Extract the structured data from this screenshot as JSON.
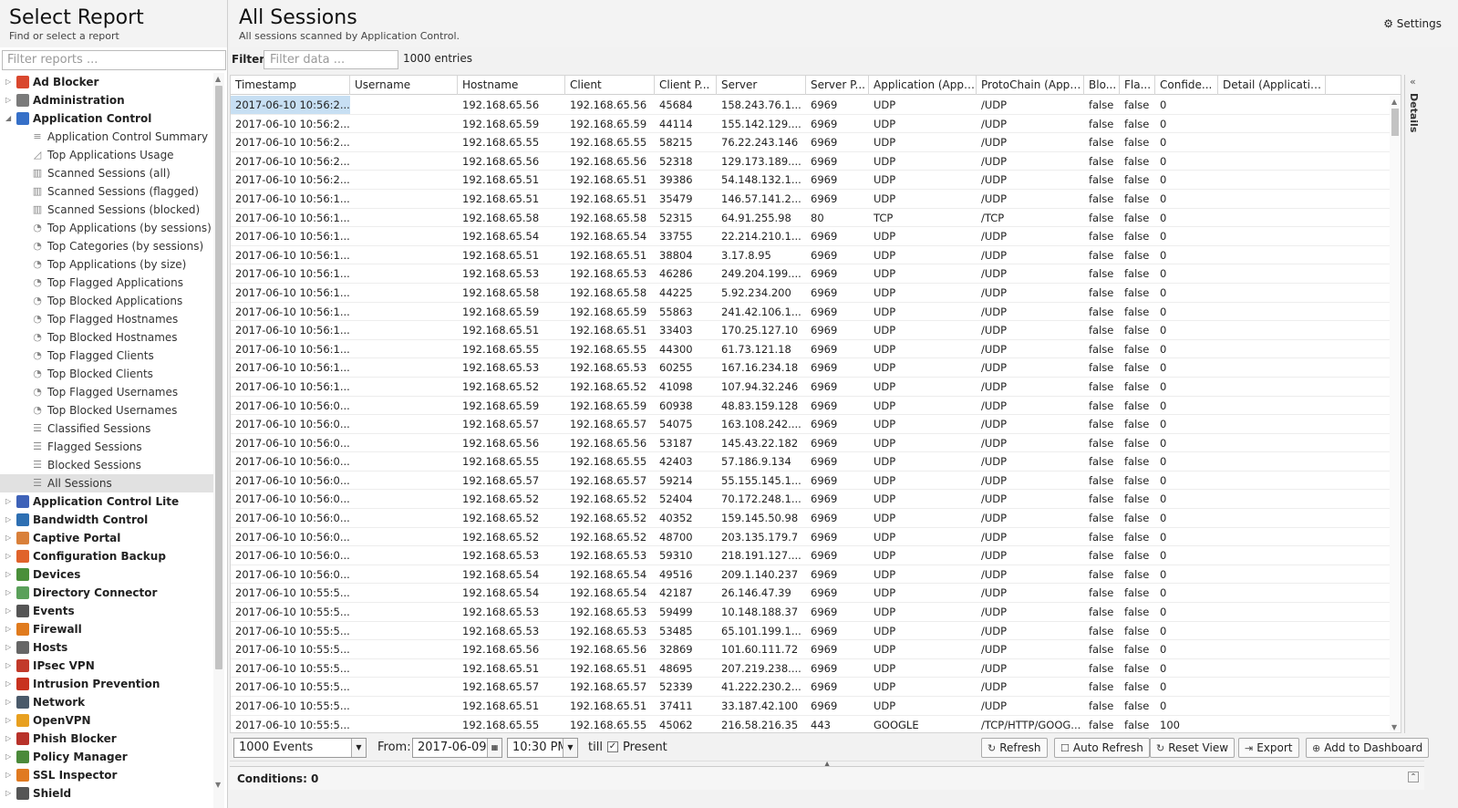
{
  "left_panel": {
    "title": "Select Report",
    "subtitle": "Find or select a report",
    "filter_placeholder": "Filter reports ..."
  },
  "tree": [
    {
      "label": "Ad Blocker",
      "type": "app",
      "color": "#d9472e",
      "expanded": false
    },
    {
      "label": "Administration",
      "type": "app",
      "color": "#7a7a7a",
      "expanded": false
    },
    {
      "label": "Application Control",
      "type": "app",
      "color": "#3670c8",
      "expanded": true
    },
    {
      "label": "Application Control Summary",
      "type": "report",
      "icon": "≡"
    },
    {
      "label": "Top Applications Usage",
      "type": "report",
      "icon": "◿"
    },
    {
      "label": "Scanned Sessions (all)",
      "type": "report",
      "icon": "▥"
    },
    {
      "label": "Scanned Sessions (flagged)",
      "type": "report",
      "icon": "▥"
    },
    {
      "label": "Scanned Sessions (blocked)",
      "type": "report",
      "icon": "▥"
    },
    {
      "label": "Top Applications (by sessions)",
      "type": "report",
      "icon": "◔"
    },
    {
      "label": "Top Categories (by sessions)",
      "type": "report",
      "icon": "◔"
    },
    {
      "label": "Top Applications (by size)",
      "type": "report",
      "icon": "◔"
    },
    {
      "label": "Top Flagged Applications",
      "type": "report",
      "icon": "◔"
    },
    {
      "label": "Top Blocked Applications",
      "type": "report",
      "icon": "◔"
    },
    {
      "label": "Top Flagged Hostnames",
      "type": "report",
      "icon": "◔"
    },
    {
      "label": "Top Blocked Hostnames",
      "type": "report",
      "icon": "◔"
    },
    {
      "label": "Top Flagged Clients",
      "type": "report",
      "icon": "◔"
    },
    {
      "label": "Top Blocked Clients",
      "type": "report",
      "icon": "◔"
    },
    {
      "label": "Top Flagged Usernames",
      "type": "report",
      "icon": "◔"
    },
    {
      "label": "Top Blocked Usernames",
      "type": "report",
      "icon": "◔"
    },
    {
      "label": "Classified Sessions",
      "type": "report",
      "icon": "☰"
    },
    {
      "label": "Flagged Sessions",
      "type": "report",
      "icon": "☰"
    },
    {
      "label": "Blocked Sessions",
      "type": "report",
      "icon": "☰"
    },
    {
      "label": "All Sessions",
      "type": "report",
      "icon": "☰",
      "selected": true
    },
    {
      "label": "Application Control Lite",
      "type": "app",
      "color": "#3e62b8",
      "expanded": false
    },
    {
      "label": "Bandwidth Control",
      "type": "app",
      "color": "#2e6fb2",
      "expanded": false
    },
    {
      "label": "Captive Portal",
      "type": "app",
      "color": "#d9803a",
      "expanded": false
    },
    {
      "label": "Configuration Backup",
      "type": "app",
      "color": "#e0632b",
      "expanded": false
    },
    {
      "label": "Devices",
      "type": "app",
      "color": "#4a8f3a",
      "expanded": false
    },
    {
      "label": "Directory Connector",
      "type": "app",
      "color": "#5aa05a",
      "expanded": false
    },
    {
      "label": "Events",
      "type": "app",
      "color": "#555",
      "expanded": false
    },
    {
      "label": "Firewall",
      "type": "app",
      "color": "#e07b1e",
      "expanded": false
    },
    {
      "label": "Hosts",
      "type": "app",
      "color": "#666",
      "expanded": false
    },
    {
      "label": "IPsec VPN",
      "type": "app",
      "color": "#c23a2a",
      "expanded": false
    },
    {
      "label": "Intrusion Prevention",
      "type": "app",
      "color": "#c8321f",
      "expanded": false
    },
    {
      "label": "Network",
      "type": "app",
      "color": "#4a5a6a",
      "expanded": false
    },
    {
      "label": "OpenVPN",
      "type": "app",
      "color": "#e8a020",
      "expanded": false
    },
    {
      "label": "Phish Blocker",
      "type": "app",
      "color": "#b8322a",
      "expanded": false
    },
    {
      "label": "Policy Manager",
      "type": "app",
      "color": "#4b8a3a",
      "expanded": false
    },
    {
      "label": "SSL Inspector",
      "type": "app",
      "color": "#e07a20",
      "expanded": false
    },
    {
      "label": "Shield",
      "type": "app",
      "color": "#555",
      "expanded": false
    }
  ],
  "main": {
    "title": "All Sessions",
    "subtitle": "All sessions scanned by Application Control.",
    "settings_label": "Settings",
    "filter_label": "Filter:",
    "filter_placeholder": "Filter data ...",
    "entries": "1000 entries"
  },
  "columns": [
    "Timestamp",
    "Username",
    "Hostname",
    "Client",
    "Client P...",
    "Server",
    "Server P...",
    "Application (Appli...",
    "ProtoChain (Appli...",
    "Blo...",
    "Fla...",
    "Confide...",
    "Detail (Applicatio..."
  ],
  "rows": [
    [
      "2017-06-10 10:56:2...",
      "",
      "192.168.65.56",
      "192.168.65.56",
      "45684",
      "158.243.76.1...",
      "6969",
      "UDP",
      "/UDP",
      "false",
      "false",
      "0",
      ""
    ],
    [
      "2017-06-10 10:56:2...",
      "",
      "192.168.65.59",
      "192.168.65.59",
      "44114",
      "155.142.129....",
      "6969",
      "UDP",
      "/UDP",
      "false",
      "false",
      "0",
      ""
    ],
    [
      "2017-06-10 10:56:2...",
      "",
      "192.168.65.55",
      "192.168.65.55",
      "58215",
      "76.22.243.146",
      "6969",
      "UDP",
      "/UDP",
      "false",
      "false",
      "0",
      ""
    ],
    [
      "2017-06-10 10:56:2...",
      "",
      "192.168.65.56",
      "192.168.65.56",
      "52318",
      "129.173.189....",
      "6969",
      "UDP",
      "/UDP",
      "false",
      "false",
      "0",
      ""
    ],
    [
      "2017-06-10 10:56:2...",
      "",
      "192.168.65.51",
      "192.168.65.51",
      "39386",
      "54.148.132.1...",
      "6969",
      "UDP",
      "/UDP",
      "false",
      "false",
      "0",
      ""
    ],
    [
      "2017-06-10 10:56:1...",
      "",
      "192.168.65.51",
      "192.168.65.51",
      "35479",
      "146.57.141.2...",
      "6969",
      "UDP",
      "/UDP",
      "false",
      "false",
      "0",
      ""
    ],
    [
      "2017-06-10 10:56:1...",
      "",
      "192.168.65.58",
      "192.168.65.58",
      "52315",
      "64.91.255.98",
      "80",
      "TCP",
      "/TCP",
      "false",
      "false",
      "0",
      ""
    ],
    [
      "2017-06-10 10:56:1...",
      "",
      "192.168.65.54",
      "192.168.65.54",
      "33755",
      "22.214.210.1...",
      "6969",
      "UDP",
      "/UDP",
      "false",
      "false",
      "0",
      ""
    ],
    [
      "2017-06-10 10:56:1...",
      "",
      "192.168.65.51",
      "192.168.65.51",
      "38804",
      "3.17.8.95",
      "6969",
      "UDP",
      "/UDP",
      "false",
      "false",
      "0",
      ""
    ],
    [
      "2017-06-10 10:56:1...",
      "",
      "192.168.65.53",
      "192.168.65.53",
      "46286",
      "249.204.199....",
      "6969",
      "UDP",
      "/UDP",
      "false",
      "false",
      "0",
      ""
    ],
    [
      "2017-06-10 10:56:1...",
      "",
      "192.168.65.58",
      "192.168.65.58",
      "44225",
      "5.92.234.200",
      "6969",
      "UDP",
      "/UDP",
      "false",
      "false",
      "0",
      ""
    ],
    [
      "2017-06-10 10:56:1...",
      "",
      "192.168.65.59",
      "192.168.65.59",
      "55863",
      "241.42.106.1...",
      "6969",
      "UDP",
      "/UDP",
      "false",
      "false",
      "0",
      ""
    ],
    [
      "2017-06-10 10:56:1...",
      "",
      "192.168.65.51",
      "192.168.65.51",
      "33403",
      "170.25.127.10",
      "6969",
      "UDP",
      "/UDP",
      "false",
      "false",
      "0",
      ""
    ],
    [
      "2017-06-10 10:56:1...",
      "",
      "192.168.65.55",
      "192.168.65.55",
      "44300",
      "61.73.121.18",
      "6969",
      "UDP",
      "/UDP",
      "false",
      "false",
      "0",
      ""
    ],
    [
      "2017-06-10 10:56:1...",
      "",
      "192.168.65.53",
      "192.168.65.53",
      "60255",
      "167.16.234.18",
      "6969",
      "UDP",
      "/UDP",
      "false",
      "false",
      "0",
      ""
    ],
    [
      "2017-06-10 10:56:1...",
      "",
      "192.168.65.52",
      "192.168.65.52",
      "41098",
      "107.94.32.246",
      "6969",
      "UDP",
      "/UDP",
      "false",
      "false",
      "0",
      ""
    ],
    [
      "2017-06-10 10:56:0...",
      "",
      "192.168.65.59",
      "192.168.65.59",
      "60938",
      "48.83.159.128",
      "6969",
      "UDP",
      "/UDP",
      "false",
      "false",
      "0",
      ""
    ],
    [
      "2017-06-10 10:56:0...",
      "",
      "192.168.65.57",
      "192.168.65.57",
      "54075",
      "163.108.242....",
      "6969",
      "UDP",
      "/UDP",
      "false",
      "false",
      "0",
      ""
    ],
    [
      "2017-06-10 10:56:0...",
      "",
      "192.168.65.56",
      "192.168.65.56",
      "53187",
      "145.43.22.182",
      "6969",
      "UDP",
      "/UDP",
      "false",
      "false",
      "0",
      ""
    ],
    [
      "2017-06-10 10:56:0...",
      "",
      "192.168.65.55",
      "192.168.65.55",
      "42403",
      "57.186.9.134",
      "6969",
      "UDP",
      "/UDP",
      "false",
      "false",
      "0",
      ""
    ],
    [
      "2017-06-10 10:56:0...",
      "",
      "192.168.65.57",
      "192.168.65.57",
      "59214",
      "55.155.145.1...",
      "6969",
      "UDP",
      "/UDP",
      "false",
      "false",
      "0",
      ""
    ],
    [
      "2017-06-10 10:56:0...",
      "",
      "192.168.65.52",
      "192.168.65.52",
      "52404",
      "70.172.248.1...",
      "6969",
      "UDP",
      "/UDP",
      "false",
      "false",
      "0",
      ""
    ],
    [
      "2017-06-10 10:56:0...",
      "",
      "192.168.65.52",
      "192.168.65.52",
      "40352",
      "159.145.50.98",
      "6969",
      "UDP",
      "/UDP",
      "false",
      "false",
      "0",
      ""
    ],
    [
      "2017-06-10 10:56:0...",
      "",
      "192.168.65.52",
      "192.168.65.52",
      "48700",
      "203.135.179.7",
      "6969",
      "UDP",
      "/UDP",
      "false",
      "false",
      "0",
      ""
    ],
    [
      "2017-06-10 10:56:0...",
      "",
      "192.168.65.53",
      "192.168.65.53",
      "59310",
      "218.191.127....",
      "6969",
      "UDP",
      "/UDP",
      "false",
      "false",
      "0",
      ""
    ],
    [
      "2017-06-10 10:56:0...",
      "",
      "192.168.65.54",
      "192.168.65.54",
      "49516",
      "209.1.140.237",
      "6969",
      "UDP",
      "/UDP",
      "false",
      "false",
      "0",
      ""
    ],
    [
      "2017-06-10 10:55:5...",
      "",
      "192.168.65.54",
      "192.168.65.54",
      "42187",
      "26.146.47.39",
      "6969",
      "UDP",
      "/UDP",
      "false",
      "false",
      "0",
      ""
    ],
    [
      "2017-06-10 10:55:5...",
      "",
      "192.168.65.53",
      "192.168.65.53",
      "59499",
      "10.148.188.37",
      "6969",
      "UDP",
      "/UDP",
      "false",
      "false",
      "0",
      ""
    ],
    [
      "2017-06-10 10:55:5...",
      "",
      "192.168.65.53",
      "192.168.65.53",
      "53485",
      "65.101.199.1...",
      "6969",
      "UDP",
      "/UDP",
      "false",
      "false",
      "0",
      ""
    ],
    [
      "2017-06-10 10:55:5...",
      "",
      "192.168.65.56",
      "192.168.65.56",
      "32869",
      "101.60.111.72",
      "6969",
      "UDP",
      "/UDP",
      "false",
      "false",
      "0",
      ""
    ],
    [
      "2017-06-10 10:55:5...",
      "",
      "192.168.65.51",
      "192.168.65.51",
      "48695",
      "207.219.238....",
      "6969",
      "UDP",
      "/UDP",
      "false",
      "false",
      "0",
      ""
    ],
    [
      "2017-06-10 10:55:5...",
      "",
      "192.168.65.57",
      "192.168.65.57",
      "52339",
      "41.222.230.2...",
      "6969",
      "UDP",
      "/UDP",
      "false",
      "false",
      "0",
      ""
    ],
    [
      "2017-06-10 10:55:5...",
      "",
      "192.168.65.51",
      "192.168.65.51",
      "37411",
      "33.187.42.100",
      "6969",
      "UDP",
      "/UDP",
      "false",
      "false",
      "0",
      ""
    ],
    [
      "2017-06-10 10:55:5...",
      "",
      "192.168.65.55",
      "192.168.65.55",
      "45062",
      "216.58.216.35",
      "443",
      "GOOGLE",
      "/TCP/HTTP/GOOG...",
      "false",
      "false",
      "100",
      ""
    ]
  ],
  "details_label": "Details",
  "bottom": {
    "events_select": "1000 Events",
    "from_label": "From:",
    "from_date": "2017-06-09",
    "from_time": "10:30 PM",
    "till_label": "till",
    "present_checked": true,
    "present_label": "Present",
    "refresh": "Refresh",
    "auto_refresh": "Auto Refresh",
    "reset_view": "Reset View",
    "export": "Export",
    "add_dashboard": "Add to Dashboard"
  },
  "conditions_label": "Conditions: 0"
}
